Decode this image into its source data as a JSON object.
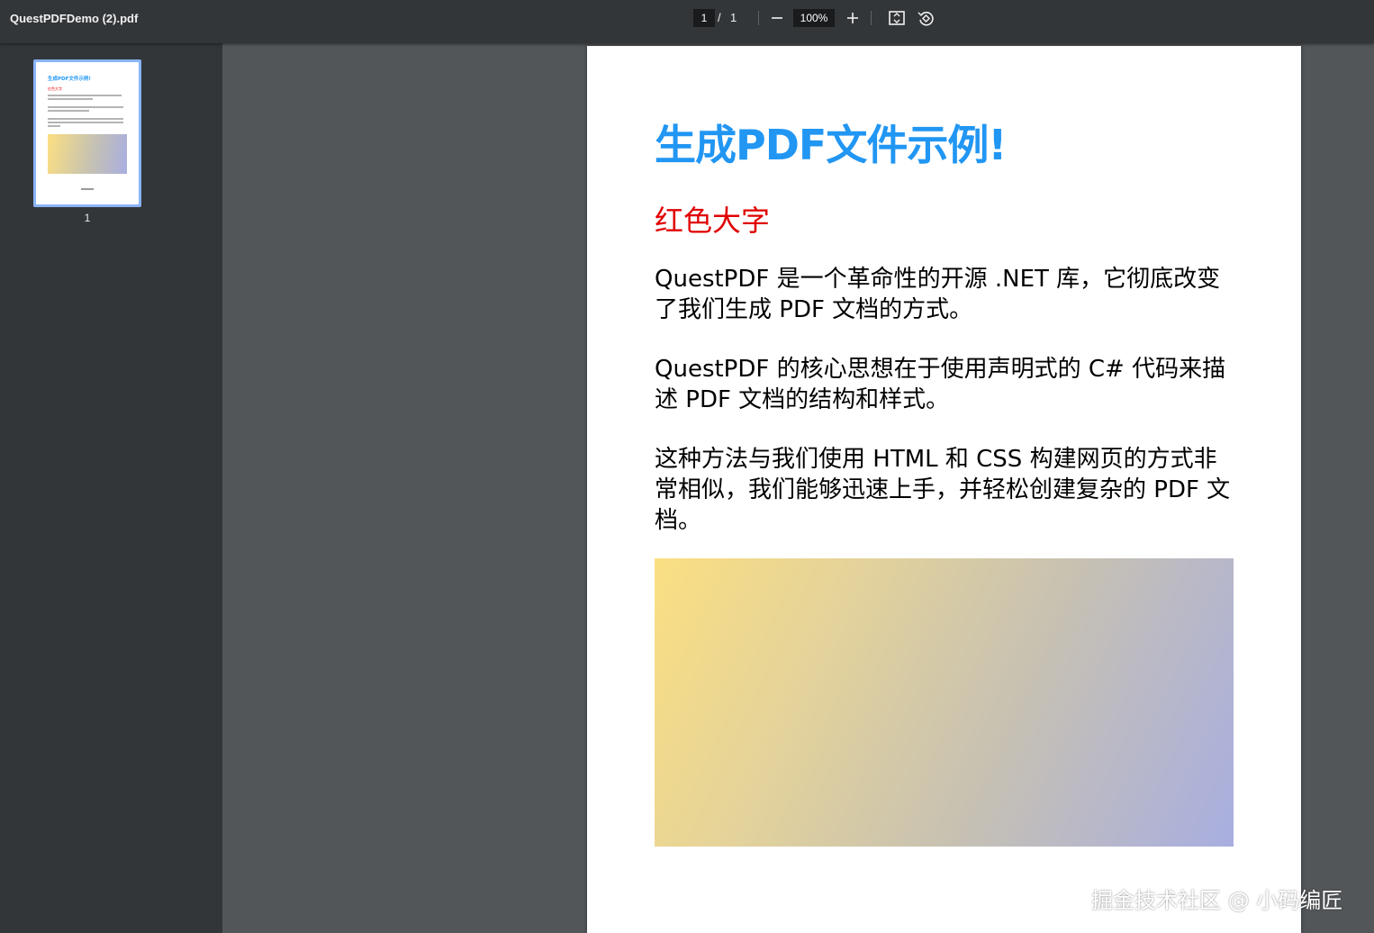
{
  "toolbar": {
    "filename": "QuestPDFDemo (2).pdf",
    "current_page": "1",
    "page_separator": "/",
    "total_pages": "1",
    "zoom": "100%"
  },
  "sidebar": {
    "thumbnails": [
      {
        "page_label": "1"
      }
    ],
    "thumbnail_text": {
      "title": "生成PDF文件示例!",
      "subtitle": "红色大字"
    }
  },
  "document": {
    "title": "生成PDF文件示例!",
    "subtitle": "红色大字",
    "paragraphs": [
      "QuestPDF 是一个革命性的开源 .NET 库，它彻底改变了我们生成 PDF 文档的方式。",
      "QuestPDF 的核心思想在于使用声明式的 C# 代码来描述 PDF 文档的结构和样式。",
      "这种方法与我们使用 HTML 和 CSS 构建网页的方式非常相似，我们能够迅速上手，并轻松创建复杂的 PDF 文档。"
    ],
    "title_color": "#2196f3",
    "subtitle_color": "#e00000",
    "gradient_colors": [
      "#fbdf82",
      "#a8aee0"
    ]
  },
  "watermark": "掘金技术社区 @ 小码编匠"
}
